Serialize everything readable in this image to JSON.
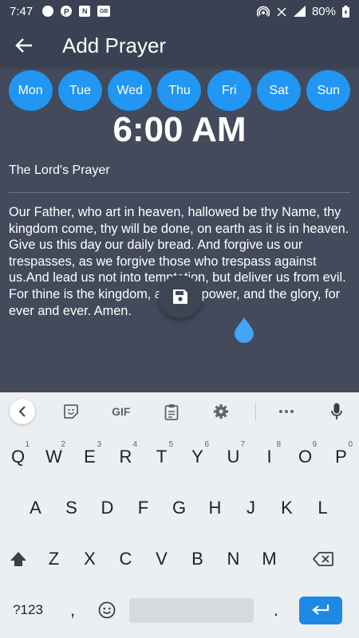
{
  "status_bar": {
    "time": "7:47",
    "battery": "80%",
    "notif_icons": [
      "circle-icon",
      "p-icon",
      "n-icon",
      "gb-icon"
    ],
    "n_badge": "N",
    "gb_badge": "GB"
  },
  "app_bar": {
    "title": "Add Prayer"
  },
  "days": [
    "Mon",
    "Tue",
    "Wed",
    "Thu",
    "Fri",
    "Sat",
    "Sun"
  ],
  "time_display": "6:00 AM",
  "prayer": {
    "title": "The Lord's Prayer",
    "body": "Our Father, who art in heaven, hallowed be thy Name, thy kingdom come, thy will be done, on earth as it is in heaven. Give us this day our daily bread. And forgive us our trespasses, as we forgive those who trespass against us.And lead us not into temptation, but deliver us from evil. For thine is the kingdom, and the power, and the glory, for ever and ever. Amen."
  },
  "keyboard": {
    "toolbar": {
      "gif_label": "GIF"
    },
    "row1": [
      {
        "key": "Q",
        "hint": "1"
      },
      {
        "key": "W",
        "hint": "2"
      },
      {
        "key": "E",
        "hint": "3"
      },
      {
        "key": "R",
        "hint": "4"
      },
      {
        "key": "T",
        "hint": "5"
      },
      {
        "key": "Y",
        "hint": "6"
      },
      {
        "key": "U",
        "hint": "7"
      },
      {
        "key": "I",
        "hint": "8"
      },
      {
        "key": "O",
        "hint": "9"
      },
      {
        "key": "P",
        "hint": "0"
      }
    ],
    "row2": [
      "A",
      "S",
      "D",
      "F",
      "G",
      "H",
      "J",
      "K",
      "L"
    ],
    "row3": [
      "Z",
      "X",
      "C",
      "V",
      "B",
      "N",
      "M"
    ],
    "symbols_label": "?123",
    "comma": ",",
    "period": "."
  },
  "colors": {
    "accent": "#2196f3",
    "background": "#424a5b",
    "appbar": "#3a4152"
  }
}
